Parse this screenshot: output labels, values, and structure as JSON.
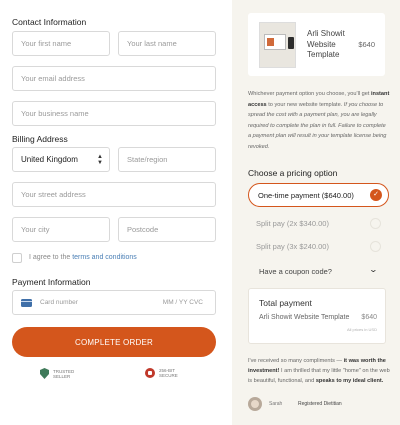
{
  "contact": {
    "heading": "Contact Information",
    "first_name_placeholder": "Your first name",
    "last_name_placeholder": "Your last name",
    "email_placeholder": "Your email address",
    "business_placeholder": "Your business name"
  },
  "billing": {
    "heading": "Billing Address",
    "country_value": "United Kingdom",
    "state_placeholder": "State/region",
    "street_placeholder": "Your street address",
    "city_placeholder": "Your city",
    "postcode_placeholder": "Postcode"
  },
  "agree": {
    "prefix": "I agree to the",
    "link": "terms and conditions"
  },
  "payment": {
    "heading": "Payment Information",
    "card_placeholder": "Card number",
    "expiry_cvc": "MM / YY  CVC"
  },
  "cta": {
    "label": "COMPLETE ORDER"
  },
  "badges": {
    "trusted_line1": "TRUSTED",
    "trusted_line2": "SELLER",
    "secure_line1": "256-BIT",
    "secure_line2": "SECURE"
  },
  "product": {
    "title": "Arli Showit Website Template",
    "price": "$640"
  },
  "blurb": {
    "p1": "Whichever payment option you choose, you'll get",
    "bold": "instant access",
    "p2": "to your new website template.",
    "italic": "If you choose to spread the cost with a payment plan, you are legally required to complete the plan in full. Failure to complete a payment plan will result in your template license being revoked."
  },
  "pricing": {
    "heading": "Choose a pricing option",
    "selected": "One-time payment ($640.00)",
    "option2": "Split pay (2x $340.00)",
    "option3": "Split pay (3x $240.00)",
    "coupon": "Have a coupon code?"
  },
  "total": {
    "heading": "Total payment",
    "item": "Arli Showit Website Template",
    "price": "$640",
    "note": "All prices in USD"
  },
  "testimonial": {
    "p1": "I've received so many compliments —",
    "bold1": "it was worth the investment!",
    "p2": "I am thrilled that my little \"home\" on the web is beautiful, functional, and",
    "bold2": "speaks to my ideal client.",
    "name": "Sarah",
    "role": "Registered Dietitian"
  },
  "colors": {
    "accent": "#d4561c",
    "sidebar_bg": "#f6f4ee",
    "link": "#4a7fb5"
  }
}
